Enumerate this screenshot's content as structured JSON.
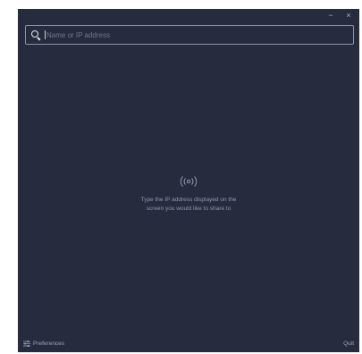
{
  "window": {
    "minimize_label": "−",
    "close_label": "×"
  },
  "search": {
    "placeholder": "Name or IP address",
    "value": ""
  },
  "empty_state": {
    "icon": "broadcast-icon",
    "line1": "Type the IP address displayed on the",
    "line2": "screen you would like to share to"
  },
  "footer": {
    "preferences_label": "Preferences",
    "preferences_icon": "sliders-icon",
    "quit_label": "Quit"
  },
  "colors": {
    "background": "#262c3e",
    "input_border": "#8793ad",
    "text": "#8f98ad"
  }
}
